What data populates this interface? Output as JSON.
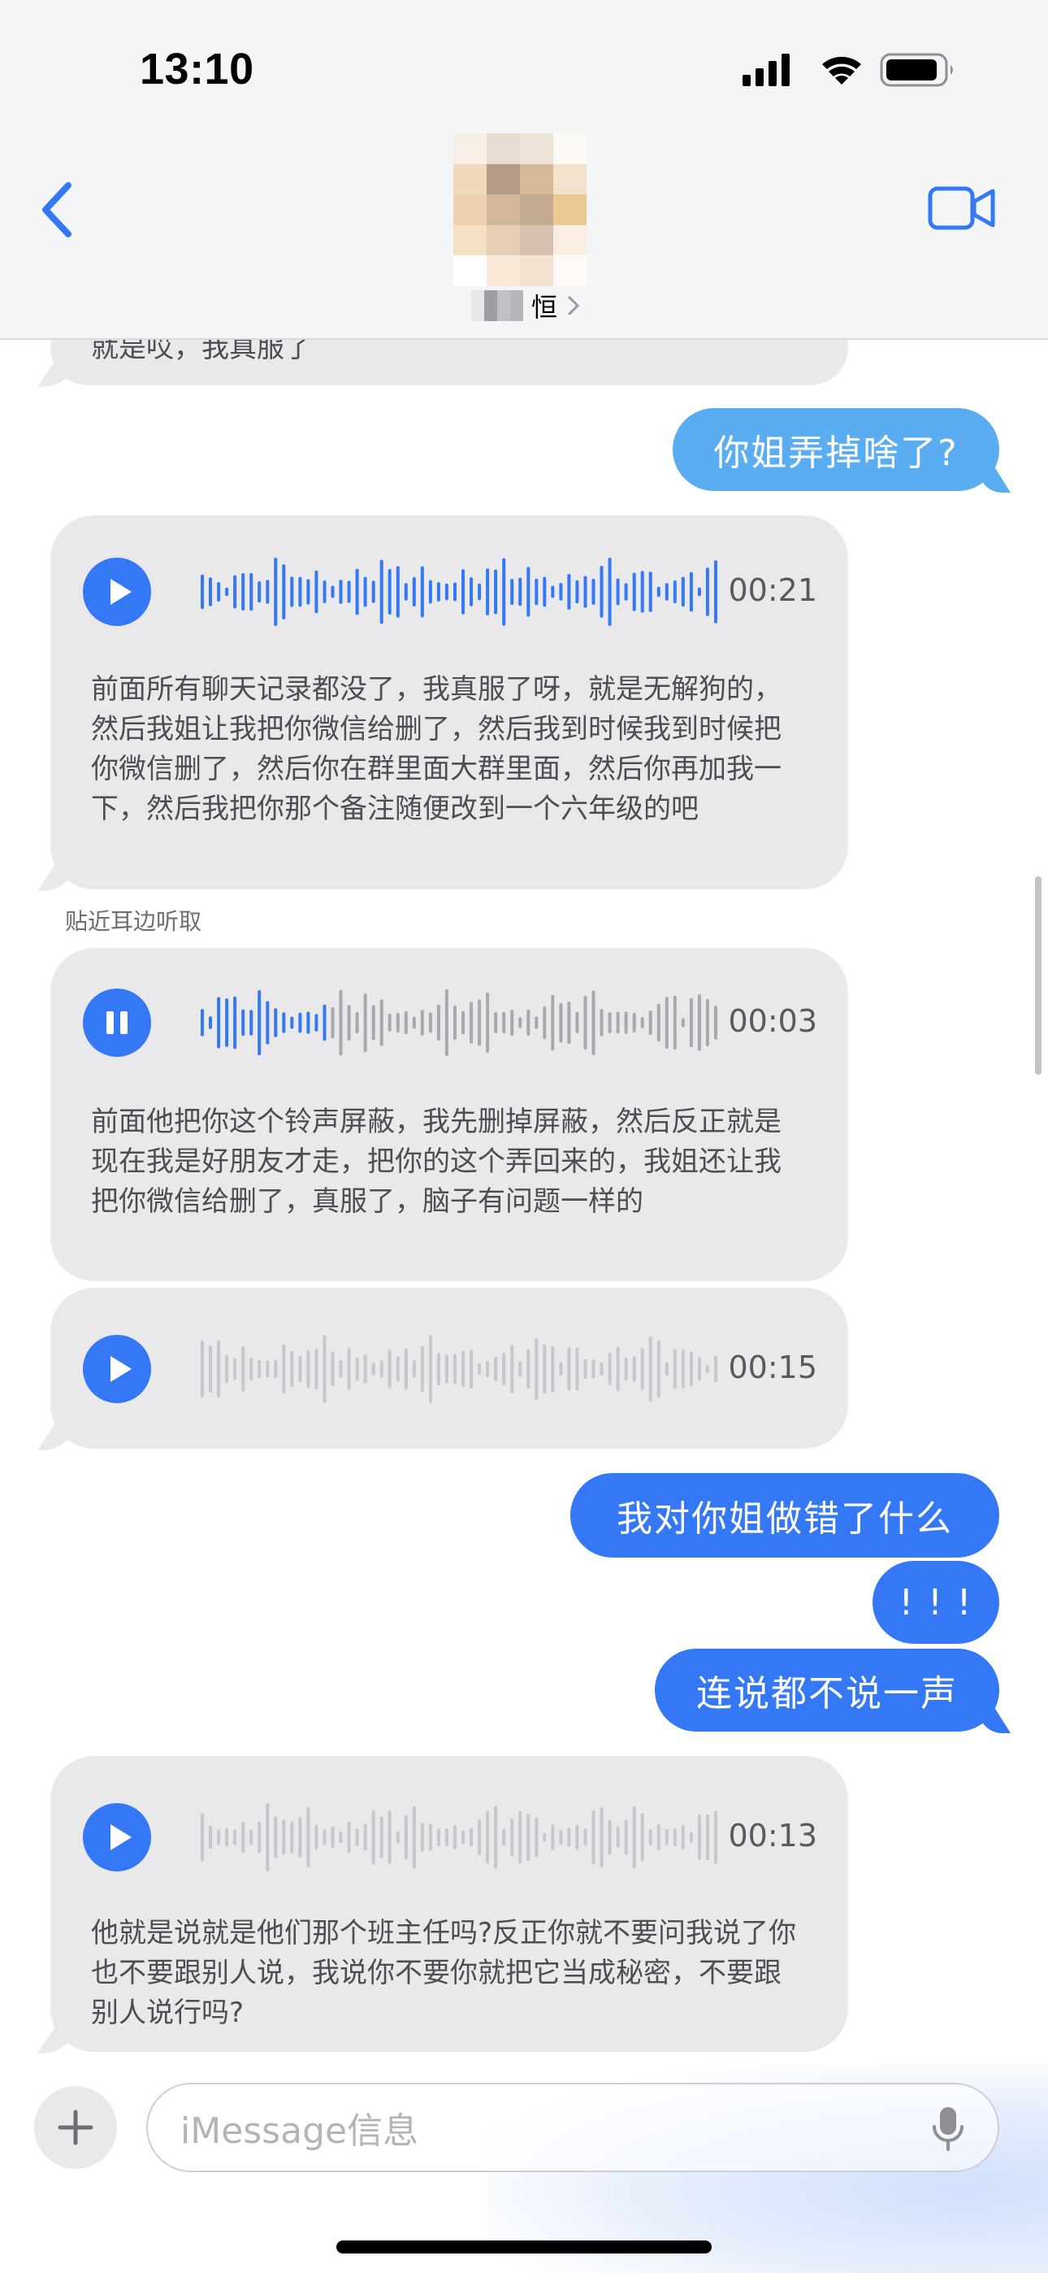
{
  "status_bar": {
    "time": "13:10"
  },
  "header": {
    "contact_name_visible_char": "恒",
    "avatar_pixels": [
      "#f8efe4",
      "#e9dccf",
      "#efe4d7",
      "#fdf9f5",
      "#f2d9b8",
      "#b89c85",
      "#d9b995",
      "#f4e2c8",
      "#f1d2ac",
      "#d7b796",
      "#c9ab90",
      "#efc88f",
      "#f6e0c2",
      "#e8cfb1",
      "#d8c2ae",
      "#fbeee0",
      "#ffffff",
      "#f9e9d6",
      "#f5e2cd",
      "#fffaf4"
    ]
  },
  "messages": {
    "top_snippet": "就是哎，我真服了",
    "out_1": "你姐弄掉啥了?",
    "voice_1": {
      "duration": "00:21",
      "transcript": "前面所有聊天记录都没了，我真服了呀，就是无解狗的，然后我姐让我把你微信给删了，然后我到时候我到时候把你微信删了，然后你在群里面大群里面，然后你再加我一下，然后我把你那个备注随便改到一个六年级的吧"
    },
    "earpiece_label": "贴近耳边听取",
    "voice_2": {
      "duration": "00:03",
      "transcript": "前面他把你这个铃声屏蔽，我先删掉屏蔽，然后反正就是现在我是好朋友才走，把你的这个弄回来的，我姐还让我把你微信给删了，真服了，脑子有问题一样的"
    },
    "voice_3": {
      "duration": "00:15"
    },
    "out_2": "我对你姐做错了什么",
    "out_3": "! ! !",
    "out_4": "连说都不说一声",
    "voice_4": {
      "duration": "00:13",
      "transcript": "他就是说就是他们那个班主任吗?反正你就不要问我说了你也不要跟别人说，我说你不要你就把它当成秘密，不要跟别人说行吗?"
    }
  },
  "composer": {
    "placeholder": "iMessage信息"
  },
  "colors": {
    "accent": "#3478f6",
    "accent_light": "#5aadf0",
    "incoming_bubble": "#e9e9eb",
    "wave_unplayed": "#c7c7cc"
  }
}
